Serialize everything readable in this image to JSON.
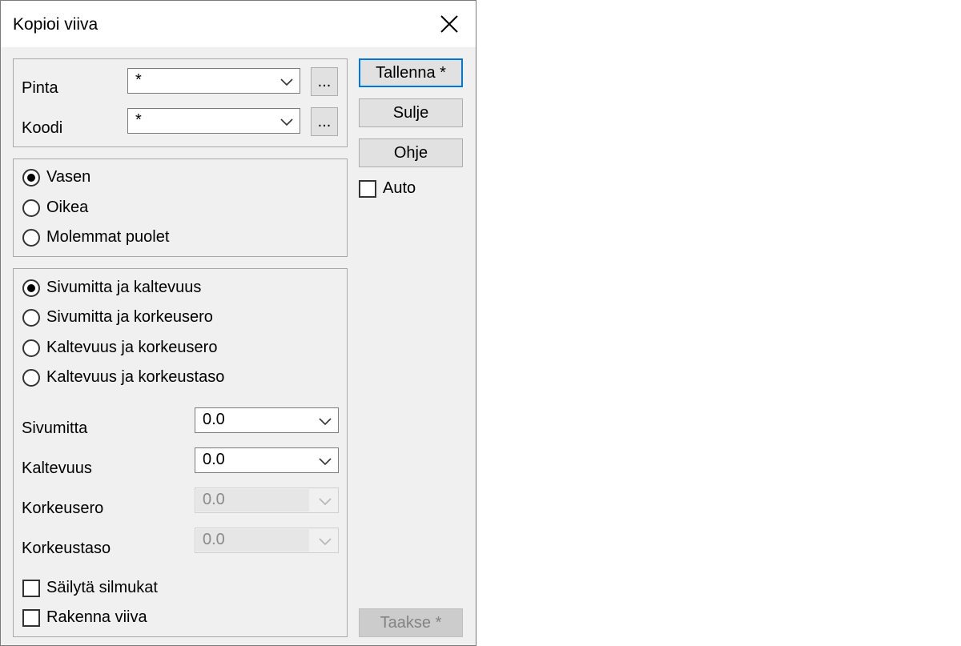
{
  "dialog": {
    "title": "Kopioi viiva"
  },
  "surface": {
    "pinta_label": "Pinta",
    "pinta_value": "*",
    "koodi_label": "Koodi",
    "koodi_value": "*",
    "browse_label": "..."
  },
  "side": {
    "options": [
      {
        "label": "Vasen",
        "selected": true
      },
      {
        "label": "Oikea",
        "selected": false
      },
      {
        "label": "Molemmat puolet",
        "selected": false
      }
    ]
  },
  "method": {
    "options": [
      {
        "label": "Sivumitta ja kaltevuus",
        "selected": true
      },
      {
        "label": "Sivumitta ja korkeusero",
        "selected": false
      },
      {
        "label": "Kaltevuus ja korkeusero",
        "selected": false
      },
      {
        "label": "Kaltevuus ja korkeustaso",
        "selected": false
      }
    ],
    "fields": [
      {
        "label": "Sivumitta",
        "value": "0.0",
        "enabled": true
      },
      {
        "label": "Kaltevuus",
        "value": "0.0",
        "enabled": true
      },
      {
        "label": "Korkeusero",
        "value": "0.0",
        "enabled": false
      },
      {
        "label": "Korkeustaso",
        "value": "0.0",
        "enabled": false
      }
    ],
    "keep_loops_label": "Säilytä silmukat",
    "keep_loops_checked": false,
    "build_line_label": "Rakenna viiva",
    "build_line_checked": false
  },
  "buttons": {
    "save": "Tallenna *",
    "close": "Sulje",
    "help": "Ohje",
    "undo": "Taakse *"
  },
  "auto": {
    "label": "Auto",
    "checked": false
  }
}
